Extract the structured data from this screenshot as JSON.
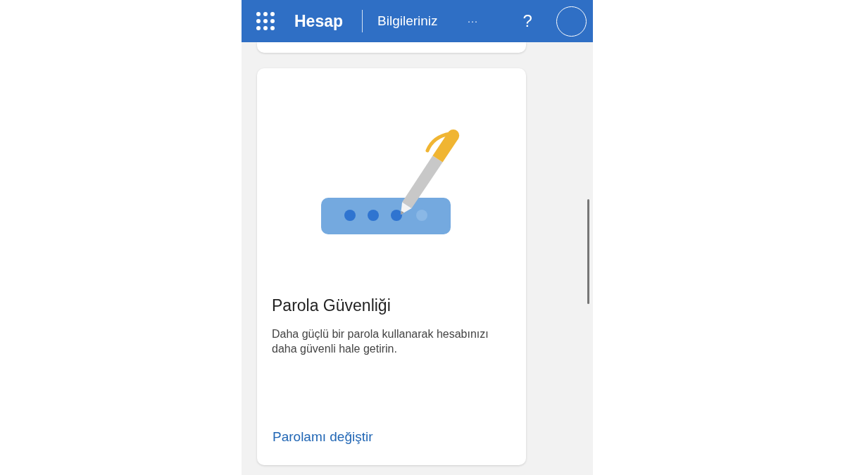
{
  "header": {
    "app_title": "Hesap",
    "section": "Bilgileriniz",
    "more": "···",
    "help": "?"
  },
  "card": {
    "title": "Parola Güvenliği",
    "description": "Daha güçlü bir parola kullanarak hesabınızı daha güvenli hale getirin.",
    "link": "Parolamı değiştir"
  }
}
